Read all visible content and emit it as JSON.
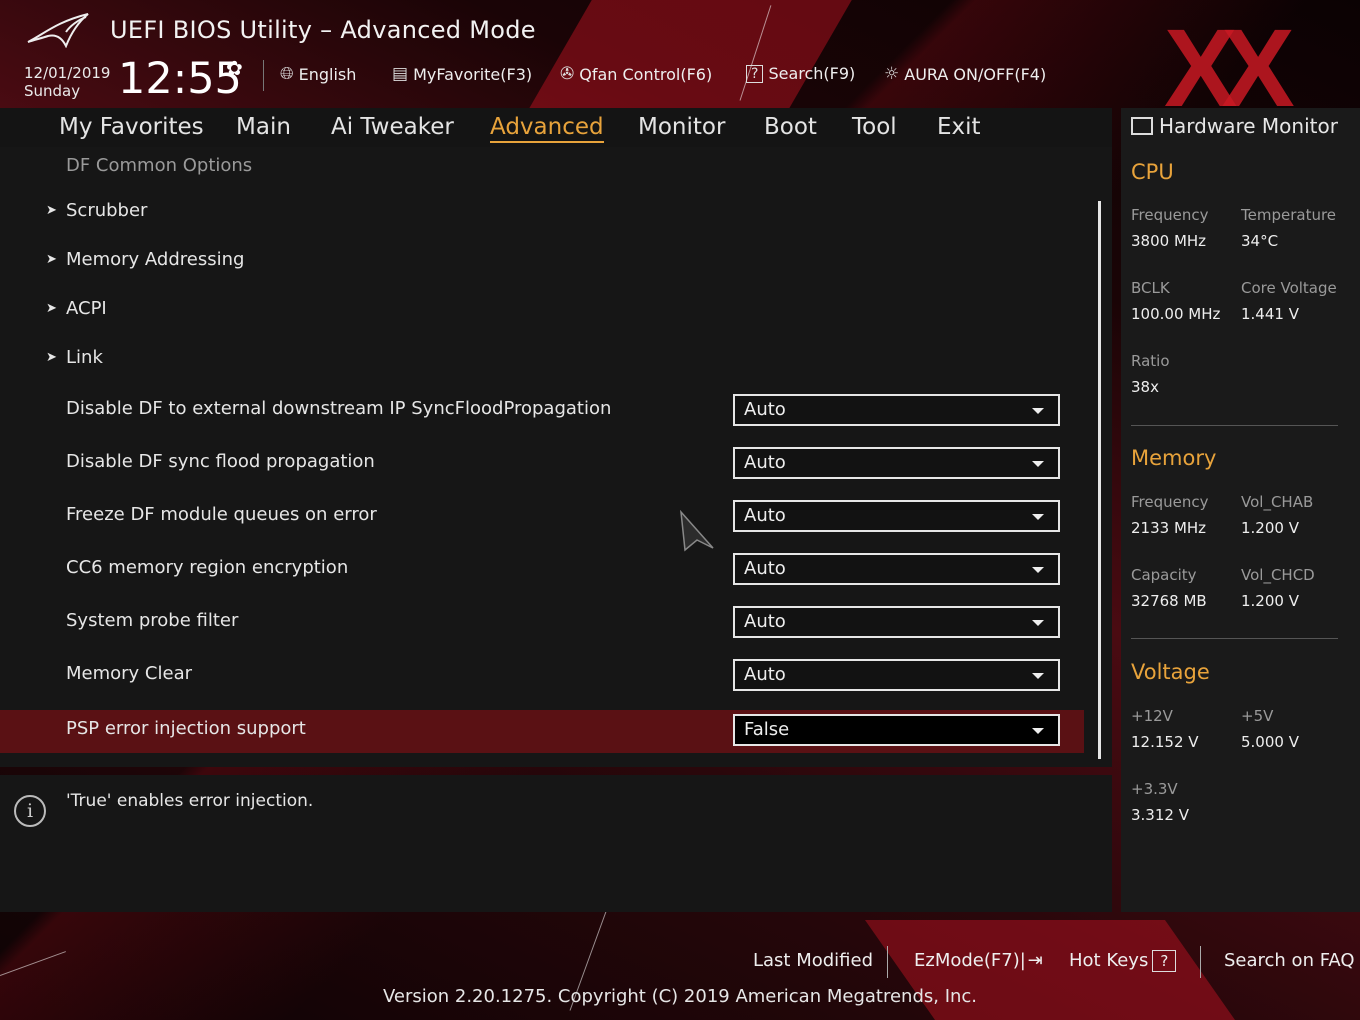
{
  "header": {
    "title": "UEFI BIOS Utility – Advanced Mode",
    "date": "12/01/2019",
    "day": "Sunday",
    "time": "12:55",
    "toolbar": {
      "language": "English",
      "favorite": "MyFavorite(F3)",
      "qfan": "Qfan Control(F6)",
      "search": "Search(F9)",
      "aura": "AURA ON/OFF(F4)"
    }
  },
  "tabs": [
    "My Favorites",
    "Main",
    "Ai Tweaker",
    "Advanced",
    "Monitor",
    "Boot",
    "Tool",
    "Exit"
  ],
  "active_tab": "Advanced",
  "main": {
    "subheading": "DF Common Options",
    "submenus": [
      "Scrubber",
      "Memory Addressing",
      "ACPI",
      "Link"
    ],
    "settings": [
      {
        "label": "Disable DF to external downstream IP SyncFloodPropagation",
        "value": "Auto"
      },
      {
        "label": "Disable DF sync flood propagation",
        "value": "Auto"
      },
      {
        "label": "Freeze DF module queues on error",
        "value": "Auto"
      },
      {
        "label": "CC6 memory region encryption",
        "value": "Auto"
      },
      {
        "label": "System probe filter",
        "value": "Auto"
      },
      {
        "label": "Memory Clear",
        "value": "Auto"
      },
      {
        "label": "PSP error injection support",
        "value": "False",
        "selected": true
      }
    ]
  },
  "info": {
    "text": "'True' enables error injection."
  },
  "hw_monitor": {
    "title": "Hardware Monitor",
    "cpu": {
      "title": "CPU",
      "frequency_label": "Frequency",
      "frequency": "3800 MHz",
      "temperature_label": "Temperature",
      "temperature": "34°C",
      "bclk_label": "BCLK",
      "bclk": "100.00 MHz",
      "core_voltage_label": "Core Voltage",
      "core_voltage": "1.441 V",
      "ratio_label": "Ratio",
      "ratio": "38x"
    },
    "memory": {
      "title": "Memory",
      "frequency_label": "Frequency",
      "frequency": "2133 MHz",
      "vol_chab_label": "Vol_CHAB",
      "vol_chab": "1.200 V",
      "capacity_label": "Capacity",
      "capacity": "32768 MB",
      "vol_chcd_label": "Vol_CHCD",
      "vol_chcd": "1.200 V"
    },
    "voltage": {
      "title": "Voltage",
      "v12_label": "+12V",
      "v12": "12.152 V",
      "v5_label": "+5V",
      "v5": "5.000 V",
      "v33_label": "+3.3V",
      "v33": "3.312 V"
    }
  },
  "footer": {
    "last_modified": "Last Modified",
    "ezmode": "EzMode(F7)|",
    "hotkeys": "Hot Keys",
    "hotkeys_key": "?",
    "faq": "Search on FAQ",
    "version": "Version 2.20.1275. Copyright (C) 2019 American Megatrends, Inc."
  },
  "colors": {
    "accent": "#e8a33b",
    "selected_row": "#5a1114",
    "brand_red": "#c8192d"
  }
}
